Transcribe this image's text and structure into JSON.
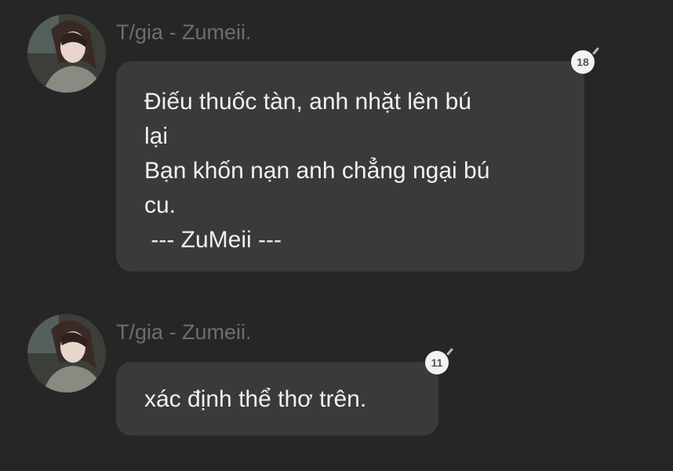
{
  "messages": [
    {
      "sender": "T/gia - Zumeii.",
      "lines": [
        "Điếu thuốc tàn, anh nhặt lên bú",
        "lại",
        "Bạn khốn nạn anh chẳng ngại bú",
        "cu.",
        " --- ZuMeii ---"
      ],
      "reaction_count": "18"
    },
    {
      "sender": "T/gia - Zumeii.",
      "lines": [
        "xác định thể thơ trên."
      ],
      "reaction_count": "11"
    }
  ]
}
